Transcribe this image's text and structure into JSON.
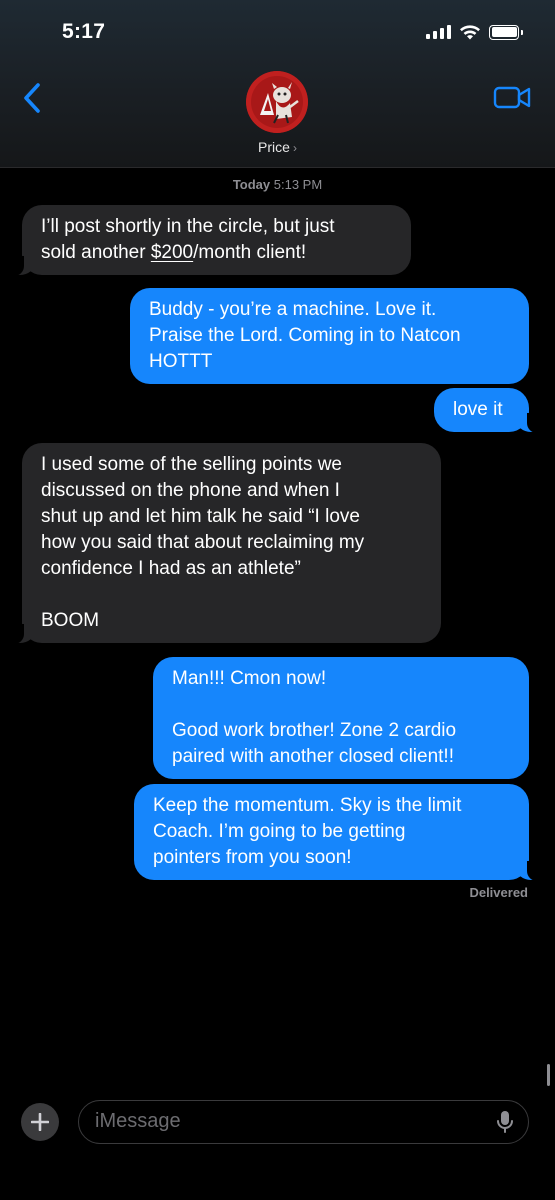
{
  "status_bar": {
    "time": "5:17"
  },
  "header": {
    "contact_name": "Price",
    "chevron": "›",
    "back_icon": "chevron-left-icon",
    "video_icon": "video-camera-icon",
    "accent_color": "#1686fc"
  },
  "thread": {
    "timestamp_day": "Today",
    "timestamp_time": "5:13 PM",
    "messages": [
      {
        "direction": "received",
        "pre": "I’ll post shortly in the circle, but just\nsold another ",
        "underlined": "$200",
        "post": "/month client!"
      },
      {
        "direction": "sent",
        "text": "Buddy - you’re a machine. Love it.\nPraise the Lord. Coming in to Natcon\nHOTTT"
      },
      {
        "direction": "sent",
        "text": "love it"
      },
      {
        "direction": "received",
        "text": "I used some of the selling points we\ndiscussed on the phone and when I\nshut up and let him talk he said “I love\nhow you said that about reclaiming my\nconfidence I had as an athlete”\n\nBOOM"
      },
      {
        "direction": "sent",
        "text": "Man!!! Cmon now!\n\nGood work brother!  Zone 2 cardio\npaired with another closed client!!"
      },
      {
        "direction": "sent",
        "text": "Keep the momentum. Sky is the limit\nCoach. I’m going to be getting\npointers from you soon!"
      }
    ],
    "delivery_status": "Delivered"
  },
  "composer": {
    "placeholder": "iMessage",
    "plus_icon": "plus-icon",
    "mic_icon": "microphone-icon"
  },
  "colors": {
    "sent_bubble": "#1686fc",
    "received_bubble": "#262628",
    "background": "#000000",
    "meta_text": "#8e8e93"
  }
}
